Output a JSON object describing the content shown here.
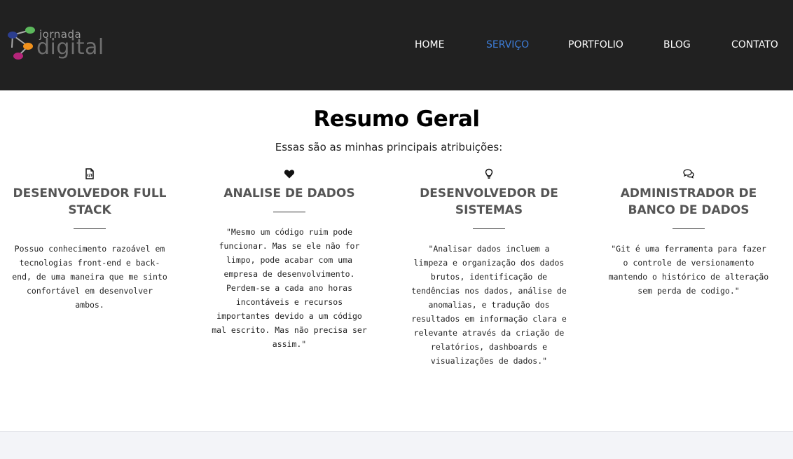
{
  "header": {
    "logo": {
      "word_top": "jornada",
      "word_bottom": "digital"
    },
    "nav": [
      {
        "label": "HOME",
        "active": false
      },
      {
        "label": "SERVIÇO",
        "active": true
      },
      {
        "label": "PORTFOLIO",
        "active": false
      },
      {
        "label": "BLOG",
        "active": false
      },
      {
        "label": "CONTATO",
        "active": false
      }
    ],
    "active_color": "#3d7dd8"
  },
  "main": {
    "title": "Resumo Geral",
    "subtitle": "Essas são as minhas principais atribuições:",
    "columns": [
      {
        "icon": "file-code-icon",
        "title": "DESENVOLVEDOR FULL STACK",
        "text": "Possuo conhecimento razoável em tecnologias front-end e back-end, de uma maneira que me sinto confortável em desenvolver ambos."
      },
      {
        "icon": "heart-icon",
        "title": "ANALISE DE DADOS",
        "text": "\"Mesmo um código ruim pode funcionar. Mas se ele não for limpo, pode acabar com uma empresa de desenvolvimento. Perdem-se a cada ano horas incontáveis e recursos importantes devido a um código mal escrito. Mas não precisa ser assim.\""
      },
      {
        "icon": "lightbulb-icon",
        "title": "DESENVOLVEDOR DE SISTEMAS",
        "text": "\"Analisar dados incluem a limpeza e organização dos dados brutos, identificação de tendências nos dados, análise de anomalias, e tradução dos resultados em informação clara e relevante através da criação de relatórios, dashboards e visualizações de dados.\""
      },
      {
        "icon": "chat-bubbles-icon",
        "title": "ADMINISTRADOR DE BANCO DE DADOS",
        "text": "\"Git é uma ferramenta para fazer o controle de versionamento mantendo o histórico de alteração sem perda de codigo.\""
      }
    ]
  }
}
